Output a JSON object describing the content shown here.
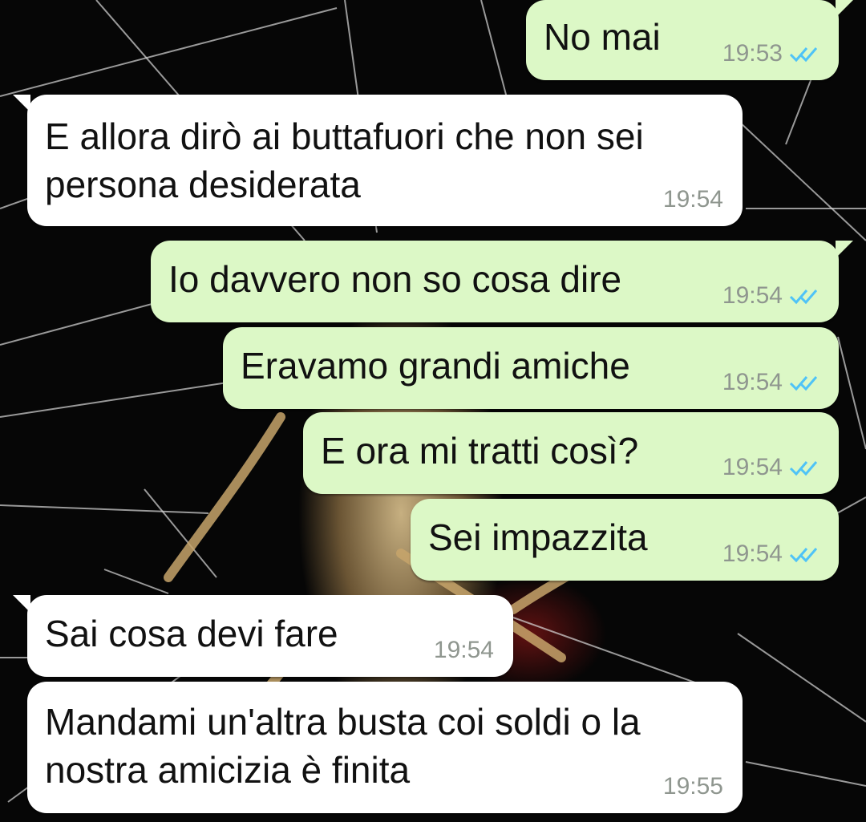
{
  "messages": [
    {
      "direction": "out",
      "text": "No mai",
      "time": "19:53",
      "status": "read"
    },
    {
      "direction": "in",
      "text": "E allora dirò ai buttafuori che non sei\npersona desiderata",
      "time": "19:54"
    },
    {
      "direction": "out",
      "text": "Io davvero non so cosa dire",
      "time": "19:54",
      "status": "read"
    },
    {
      "direction": "out",
      "text": "Eravamo grandi amiche",
      "time": "19:54",
      "status": "read"
    },
    {
      "direction": "out",
      "text": "E ora mi tratti così?",
      "time": "19:54",
      "status": "read"
    },
    {
      "direction": "out",
      "text": "Sei impazzita",
      "time": "19:54",
      "status": "read"
    },
    {
      "direction": "in",
      "text": "Sai cosa devi fare",
      "time": "19:54"
    },
    {
      "direction": "in",
      "text": "Mandami un'altra busta coi soldi o la\nnostra amicizia è finita",
      "time": "19:55"
    }
  ],
  "colors": {
    "outgoing_bubble": "#dcf8c6",
    "incoming_bubble": "#ffffff",
    "read_tick": "#4fc3f7",
    "timestamp": "#8f968f"
  },
  "icons": {
    "read_receipt": "double-check-icon",
    "wallpaper": "spider-web-wallpaper"
  }
}
